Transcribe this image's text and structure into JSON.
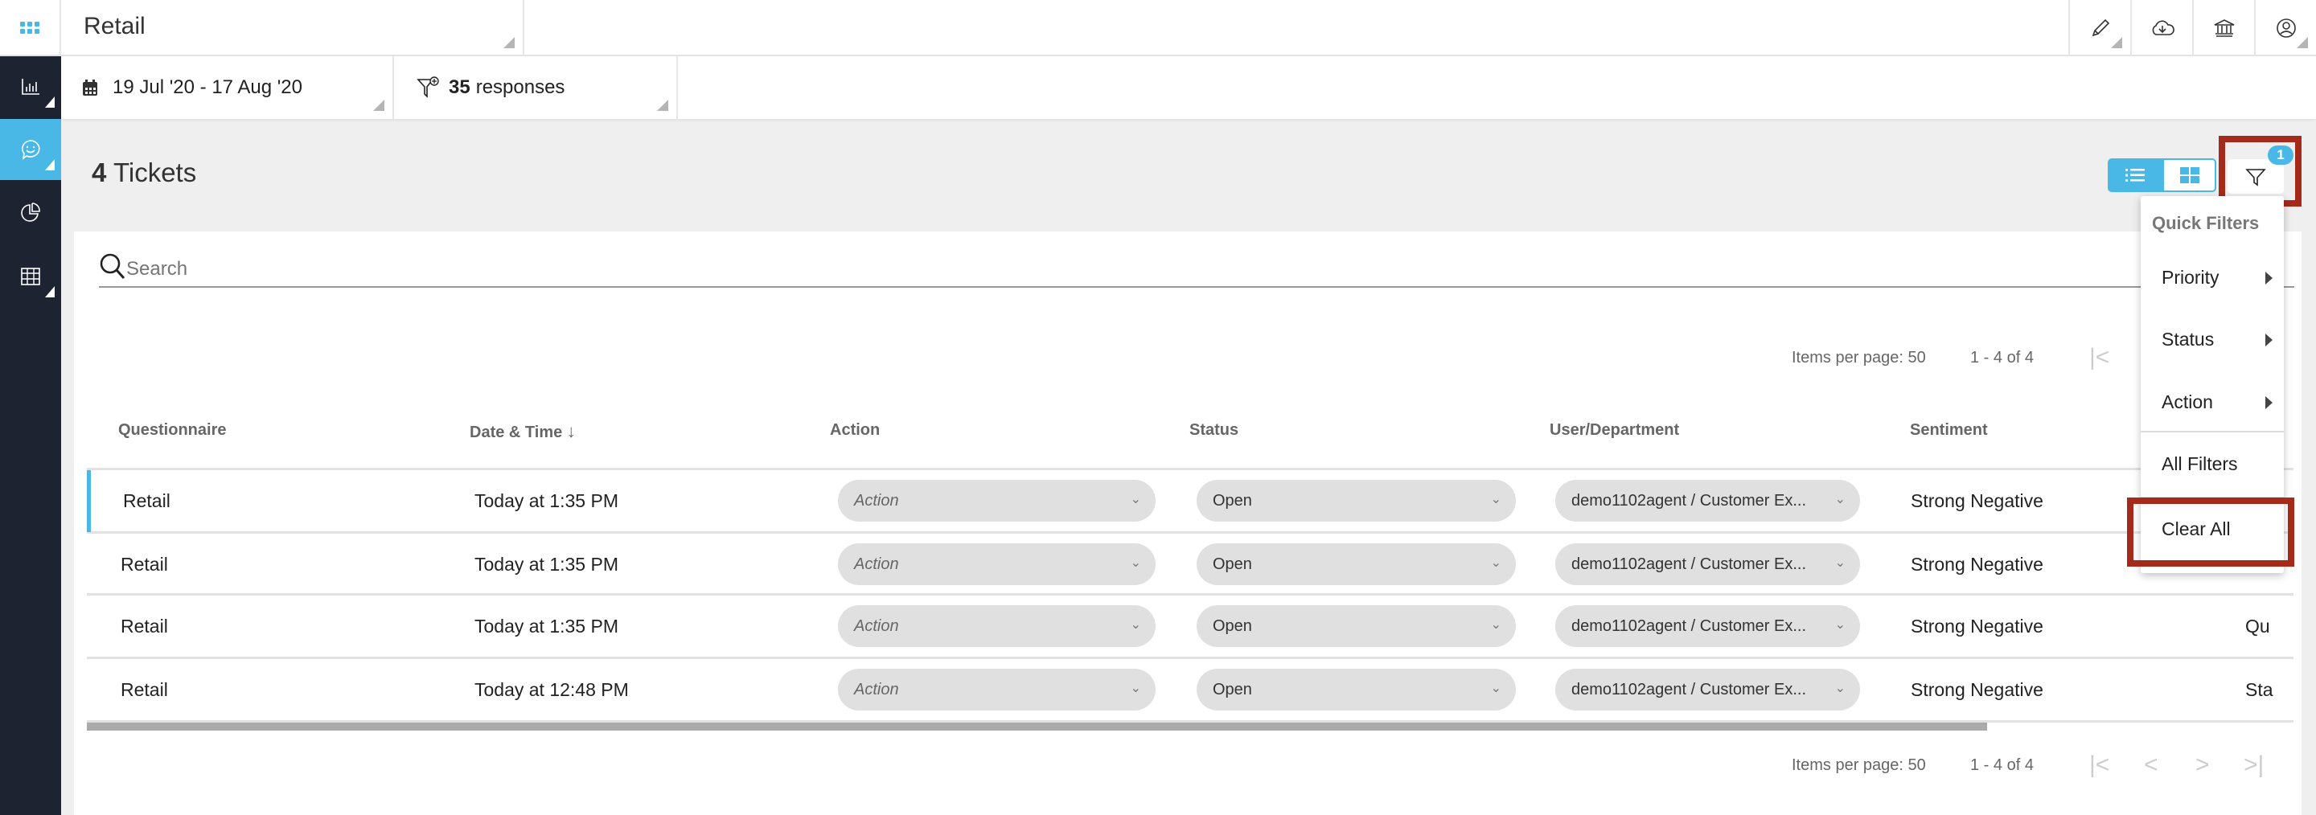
{
  "header": {
    "title": "Retail",
    "icons": [
      "pencil-icon",
      "cloud-download-icon",
      "bank-icon",
      "user-circle-icon"
    ]
  },
  "sidebar": {
    "items": [
      "bar-chart-icon",
      "chat-smile-icon",
      "pie-chart-icon",
      "table-grid-icon"
    ],
    "active": 1,
    "accent": "#4ab8e6",
    "bg": "#1d2330"
  },
  "filters": {
    "date_range": "19 Jul '20 - 17 Aug '20",
    "responses_count": "35",
    "responses_label": "responses"
  },
  "page": {
    "count": "4",
    "title": "Tickets",
    "filter_badge": "1"
  },
  "search": {
    "placeholder": "Search"
  },
  "pagination": {
    "items_per_page_label": "Items per page: 50",
    "range": "1 - 4 of 4"
  },
  "table": {
    "columns": [
      "Questionnaire",
      "Date & Time",
      "Action",
      "Status",
      "User/Department",
      "Sentiment"
    ],
    "rows": [
      {
        "questionnaire": "Retail",
        "datetime": "Today at 1:35 PM",
        "action": "Action",
        "status": "Open",
        "user": "demo1102agent / Customer Ex...",
        "sentiment": "Strong Negative",
        "extra": ""
      },
      {
        "questionnaire": "Retail",
        "datetime": "Today at 1:35 PM",
        "action": "Action",
        "status": "Open",
        "user": "demo1102agent / Customer Ex...",
        "sentiment": "Strong Negative",
        "extra": ""
      },
      {
        "questionnaire": "Retail",
        "datetime": "Today at 1:35 PM",
        "action": "Action",
        "status": "Open",
        "user": "demo1102agent / Customer Ex...",
        "sentiment": "Strong Negative",
        "extra": "Qu"
      },
      {
        "questionnaire": "Retail",
        "datetime": "Today at 12:48 PM",
        "action": "Action",
        "status": "Open",
        "user": "demo1102agent / Customer Ex...",
        "sentiment": "Strong Negative",
        "extra": "Sta"
      }
    ]
  },
  "quick_filters": {
    "title": "Quick Filters",
    "items": [
      "Priority",
      "Status",
      "Action"
    ],
    "all_filters": "All Filters",
    "clear_all": "Clear All"
  },
  "colors": {
    "accent": "#4ab8e6",
    "highlight": "#a52a1a"
  }
}
